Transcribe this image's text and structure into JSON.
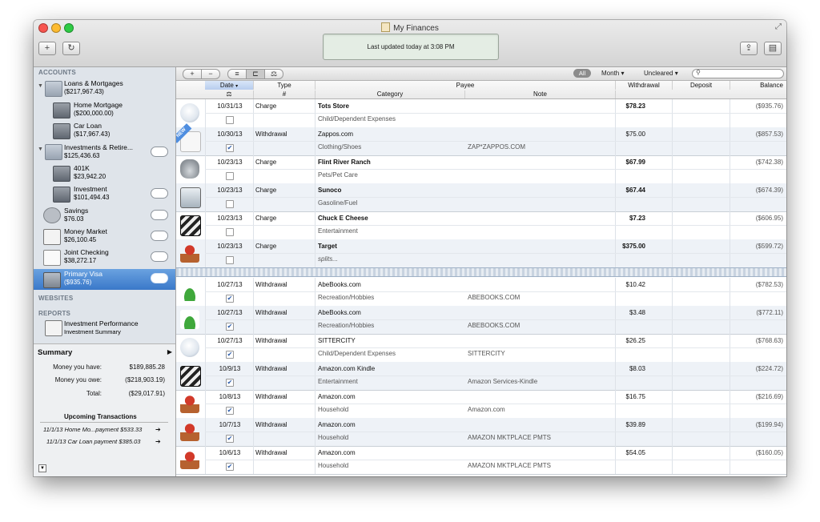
{
  "window": {
    "title": "My Finances",
    "status": "Last updated today at 3:08 PM",
    "add_label": "+",
    "refresh_label": "↻"
  },
  "sidebar": {
    "accounts_header": "ACCOUNTS",
    "websites_header": "WEBSITES",
    "reports_header": "REPORTS",
    "accounts": [
      {
        "name": "Loans & Mortgages",
        "amount": "($217,967.43)",
        "icon": "folder-icon"
      },
      {
        "name": "Home Mortgage",
        "amount": "($200,000.00)",
        "icon": "bank-icon"
      },
      {
        "name": "Car Loan",
        "amount": "($17,967.43)",
        "icon": "bank-icon"
      },
      {
        "name": "Investments & Retire...",
        "amount": "$125,436.63",
        "icon": "folder-icon"
      },
      {
        "name": "401K",
        "amount": "$23,942.20",
        "icon": "bank-icon"
      },
      {
        "name": "Investment",
        "amount": "$101,494.43",
        "icon": "bank-icon"
      },
      {
        "name": "Savings",
        "amount": "$76.03",
        "icon": "piggy-bank-icon"
      },
      {
        "name": "Money Market",
        "amount": "$26,100.45",
        "icon": "chart-icon"
      },
      {
        "name": "Joint Checking",
        "amount": "$38,272.17",
        "icon": "check-icon"
      },
      {
        "name": "Primary Visa",
        "amount": "($935.76)",
        "icon": "credit-card-icon"
      }
    ],
    "report": {
      "name": "Investment Performance",
      "sub": "Investment Summary"
    }
  },
  "summary": {
    "title": "Summary",
    "have_label": "Money you have:",
    "have_value": "$189,885.28",
    "owe_label": "Money you owe:",
    "owe_value": "($218,903.19)",
    "total_label": "Total:",
    "total_value": "($29,017.91)",
    "upcoming_title": "Upcoming Transactions",
    "upcoming": [
      "11/1/13 Home Mo...payment $533.33",
      "11/1/13 Car Loan payment $385.03"
    ]
  },
  "toolbar": {
    "add": "+",
    "remove": "−",
    "filter_all": "All",
    "filter_month": "Month",
    "filter_status": "Uncleared",
    "search_placeholder": ""
  },
  "columns": {
    "date": "Date",
    "type": "Type",
    "payee": "Payee",
    "withdrawal": "Withdrawal",
    "deposit": "Deposit",
    "balance": "Balance",
    "number": "#",
    "category": "Category",
    "note": "Note"
  },
  "transactions": [
    {
      "date": "10/31/13",
      "type": "Charge",
      "payee": "Tots Store",
      "category": "Child/Dependent Expenses",
      "note": "",
      "withdrawal": "$78.23",
      "balance": "($935.76)",
      "cleared": false,
      "bold": true,
      "icon": "baby-pacifier-icon"
    },
    {
      "date": "10/30/13",
      "type": "Withdrawal",
      "payee": "Zappos.com",
      "category": "Clothing/Shoes",
      "note": "ZAP*ZAPPOS.COM",
      "withdrawal": "$75.00",
      "balance": "($857.53)",
      "cleared": true,
      "bold": false,
      "icon": "shoe-icon",
      "new": "NEW"
    },
    {
      "date": "10/23/13",
      "type": "Charge",
      "payee": "Flint River Ranch",
      "category": "Pets/Pet Care",
      "note": "",
      "withdrawal": "$67.99",
      "balance": "($742.38)",
      "cleared": false,
      "bold": true,
      "icon": "pet-bowl-icon"
    },
    {
      "date": "10/23/13",
      "type": "Charge",
      "payee": "Sunoco",
      "category": "Gasoline/Fuel",
      "note": "",
      "withdrawal": "$67.44",
      "balance": "($674.39)",
      "cleared": false,
      "bold": true,
      "icon": "gas-pump-icon"
    },
    {
      "date": "10/23/13",
      "type": "Charge",
      "payee": "Chuck E Cheese",
      "category": "Entertainment",
      "note": "",
      "withdrawal": "$7.23",
      "balance": "($606.95)",
      "cleared": false,
      "bold": true,
      "icon": "clapperboard-icon"
    },
    {
      "date": "10/23/13",
      "type": "Charge",
      "payee": "Target",
      "category": "splits...",
      "note": "",
      "withdrawal": "$375.00",
      "balance": "($599.72)",
      "cleared": false,
      "bold": true,
      "icon": "flower-pot-icon"
    },
    {
      "date": "10/27/13",
      "type": "Withdrawal",
      "payee": "AbeBooks.com",
      "category": "Recreation/Hobbies",
      "note": "ABEBOOKS.COM",
      "withdrawal": "$10.42",
      "balance": "($782.53)",
      "cleared": true,
      "bold": false,
      "icon": "golf-flag-icon"
    },
    {
      "date": "10/27/13",
      "type": "Withdrawal",
      "payee": "AbeBooks.com",
      "category": "Recreation/Hobbies",
      "note": "ABEBOOKS.COM",
      "withdrawal": "$3.48",
      "balance": "($772.11)",
      "cleared": true,
      "bold": false,
      "icon": "golf-flag-icon"
    },
    {
      "date": "10/27/13",
      "type": "Withdrawal",
      "payee": "SITTERCITY",
      "category": "Child/Dependent Expenses",
      "note": "SITTERCITY",
      "withdrawal": "$26.25",
      "balance": "($768.63)",
      "cleared": true,
      "bold": false,
      "icon": "baby-pacifier-icon"
    },
    {
      "date": "10/9/13",
      "type": "Withdrawal",
      "payee": "Amazon.com Kindle",
      "category": "Entertainment",
      "note": "Amazon Services-Kindle",
      "withdrawal": "$8.03",
      "balance": "($224.72)",
      "cleared": true,
      "bold": false,
      "icon": "clapperboard-icon"
    },
    {
      "date": "10/8/13",
      "type": "Withdrawal",
      "payee": "Amazon.com",
      "category": "Household",
      "note": "Amazon.com",
      "withdrawal": "$16.75",
      "balance": "($216.69)",
      "cleared": true,
      "bold": false,
      "icon": "flower-pot-icon"
    },
    {
      "date": "10/7/13",
      "type": "Withdrawal",
      "payee": "Amazon.com",
      "category": "Household",
      "note": "AMAZON MKTPLACE PMTS",
      "withdrawal": "$39.89",
      "balance": "($199.94)",
      "cleared": true,
      "bold": false,
      "icon": "flower-pot-icon"
    },
    {
      "date": "10/6/13",
      "type": "Withdrawal",
      "payee": "Amazon.com",
      "category": "Household",
      "note": "AMAZON MKTPLACE PMTS",
      "withdrawal": "$54.05",
      "balance": "($160.05)",
      "cleared": true,
      "bold": false,
      "icon": "flower-pot-icon"
    }
  ]
}
